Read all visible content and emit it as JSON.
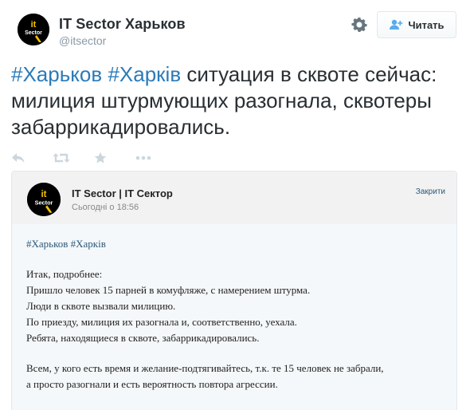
{
  "header": {
    "name": "IT Sector Харьков",
    "handle": "@itsector",
    "follow_label": "Читать",
    "avatar_text": "it Sector"
  },
  "tweet": {
    "hashtag1": "#Харьков",
    "hashtag2": "#Харків",
    "text": " ситуация в сквоте сейчас: милиция штурмующих разогнала, сквотеры забаррикадировались."
  },
  "actions": [
    "reply-icon",
    "retweet-icon",
    "favorite-icon",
    "more-icon"
  ],
  "card": {
    "source": "IT Sector | IT Сектор",
    "time": "Сьогодні о 18:56",
    "close_label": "Закрити",
    "tags": "#Харьков #Харків",
    "paragraph1": [
      "Итак, подробнее:",
      "Пришло человек 15 парней в комуфляже, с намерением штурма.",
      "Люди в сквоте вызвали милицию.",
      "По приезду, милиция их разогнала и, соответственно, уехала.",
      "Ребята, находящиеся в сквоте, забаррикадировались."
    ],
    "paragraph2": [
      "Всем, у кого есть время и желание-подтягивайтесь, т.к. те 15 человек не забрали,",
      "а просто разогнали и есть вероятность повтора агрессии."
    ]
  },
  "colors": {
    "link": "#2b7bb9",
    "text": "#292f33",
    "muted": "#8899a6",
    "card_bg": "#f5f8fa",
    "logo_yellow": "#f5c400"
  }
}
